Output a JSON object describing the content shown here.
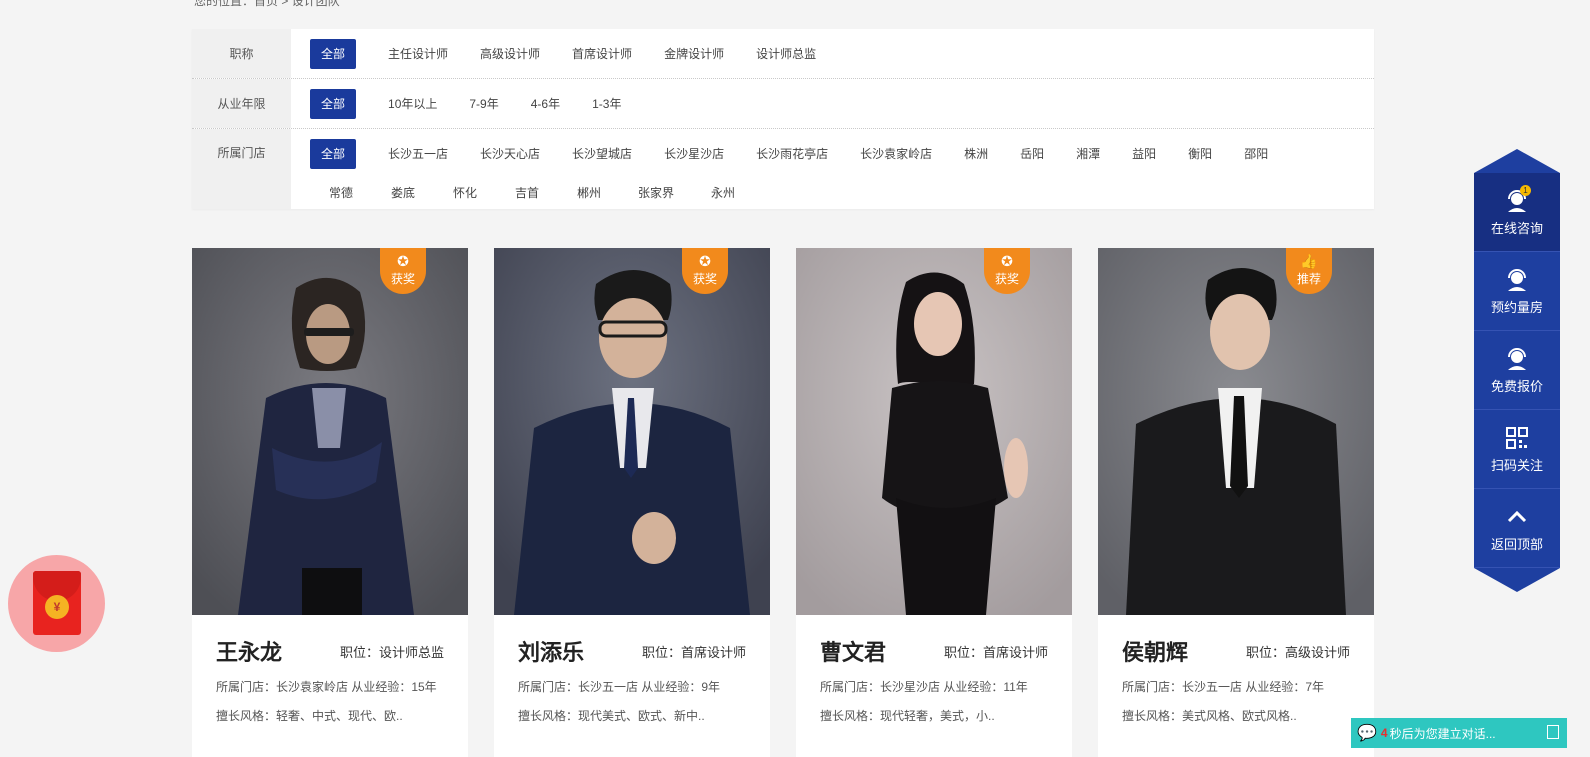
{
  "breadcrumb": "您的位置：首页 > 设计团队",
  "filters": {
    "title": {
      "label": "职称",
      "options": [
        "全部",
        "主任设计师",
        "高级设计师",
        "首席设计师",
        "金牌设计师",
        "设计师总监"
      ]
    },
    "years": {
      "label": "从业年限",
      "options": [
        "全部",
        "10年以上",
        "7-9年",
        "4-6年",
        "1-3年"
      ]
    },
    "store": {
      "label": "所属门店",
      "options": [
        "全部",
        "长沙五一店",
        "长沙天心店",
        "长沙望城店",
        "长沙星沙店",
        "长沙雨花亭店",
        "长沙袁家岭店",
        "株洲",
        "岳阳",
        "湘潭",
        "益阳",
        "衡阳",
        "邵阳"
      ],
      "options2": [
        "常德",
        "娄底",
        "怀化",
        "吉首",
        "郴州",
        "张家界",
        "永州"
      ]
    }
  },
  "designers": [
    {
      "name": "王永龙",
      "position": "职位：设计师总监",
      "store_exp": "所属门店：长沙袁家岭店 从业经验：15年",
      "style": "擅长风格：轻奢、中式、现代、欧..",
      "badge": "获奖"
    },
    {
      "name": "刘添乐",
      "position": "职位：首席设计师",
      "store_exp": "所属门店：长沙五一店 从业经验：9年",
      "style": "擅长风格：现代美式、欧式、新中..",
      "badge": "获奖"
    },
    {
      "name": "曹文君",
      "position": "职位：首席设计师",
      "store_exp": "所属门店：长沙星沙店 从业经验：11年",
      "style": "擅长风格：现代轻奢，美式，小..",
      "badge": "获奖"
    },
    {
      "name": "侯朝辉",
      "position": "职位：高级设计师",
      "store_exp": "所属门店：长沙五一店 从业经验：7年",
      "style": "擅长风格：美式风格、欧式风格..",
      "badge": "推荐"
    }
  ],
  "sidebar": {
    "items": [
      "在线咨询",
      "预约量房",
      "免费报价",
      "扫码关注",
      "返回顶部"
    ],
    "notification_count": "1"
  },
  "chat": {
    "countdown": "4",
    "text": "秒后为您建立对话..."
  },
  "colors": {
    "accent": "#1a3a9c",
    "sidebar": "#1e3fa0",
    "badge": "#f28a1c",
    "chat": "#2ec7c0"
  }
}
